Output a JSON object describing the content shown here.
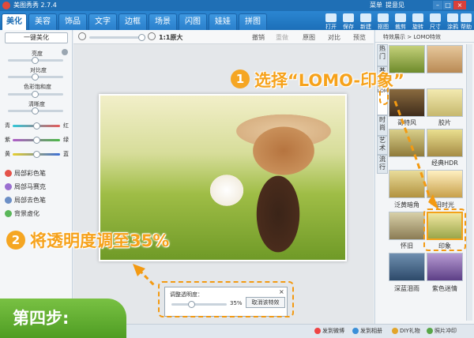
{
  "window": {
    "title": "美图秀秀 2.7.4",
    "menu": "菜单",
    "feedback": "提意见"
  },
  "tabs": [
    {
      "label": "美化",
      "active": true
    },
    {
      "label": "美容"
    },
    {
      "label": "饰品"
    },
    {
      "label": "文字"
    },
    {
      "label": "边框"
    },
    {
      "label": "场景"
    },
    {
      "label": "闪图"
    },
    {
      "label": "娃娃"
    },
    {
      "label": "拼图"
    }
  ],
  "toolbar_buttons": [
    "打开",
    "保存",
    "新建",
    "抠图",
    "裁剪",
    "旋转",
    "尺寸",
    "涂鸦",
    "帮助"
  ],
  "left_panel": {
    "one_click": "一键美化",
    "sliders": [
      "亮度",
      "对比度",
      "色彩饱和度",
      "清晰度"
    ],
    "color_rows": [
      {
        "left": "青",
        "right": "红"
      },
      {
        "left": "紫",
        "right": "绿"
      },
      {
        "left": "黄",
        "right": "蓝"
      }
    ],
    "tools": [
      "局部彩色笔",
      "局部马赛克",
      "局部去色笔",
      "背景虚化"
    ]
  },
  "canvas_toolbar": {
    "zoom_ratio": "1:1原大",
    "undo": "撤销",
    "redo": "重做",
    "original": "原图",
    "compare": "对比",
    "preview": "预览"
  },
  "right_panel": {
    "breadcrumb": "特效展示 > LOMO特效",
    "side_tabs": [
      "热门",
      "基础",
      "LOMO",
      "时尚",
      "艺术",
      "流行"
    ],
    "effects": [
      {
        "label": ""
      },
      {
        "label": ""
      },
      {
        "label": "哥特风"
      },
      {
        "label": "胶片"
      },
      {
        "label": ""
      },
      {
        "label": "经典HDR"
      },
      {
        "label": "泛黄暗角"
      },
      {
        "label": "旧时光"
      },
      {
        "label": "怀旧"
      },
      {
        "label": "印象"
      },
      {
        "label": "深蓝泪雨"
      },
      {
        "label": "紫色迷情"
      }
    ]
  },
  "dialog": {
    "title": "调整透明度：",
    "value": "35%",
    "opacity": 0.35,
    "cancel_button": "取消该特效"
  },
  "statusbar": [
    "发到微博",
    "发到相册",
    "DIY礼物",
    "照片冲印"
  ],
  "annotations": {
    "step1_number": "1",
    "step1_text": "选择“LOMO-印象”",
    "step2_number": "2",
    "step2_text": "将透明度调至35%",
    "step_badge": "第四步:"
  },
  "colors": {
    "accent_orange": "#f5a623",
    "title_blue": "#1f6fb5",
    "badge_green": "#5aaa2b"
  }
}
